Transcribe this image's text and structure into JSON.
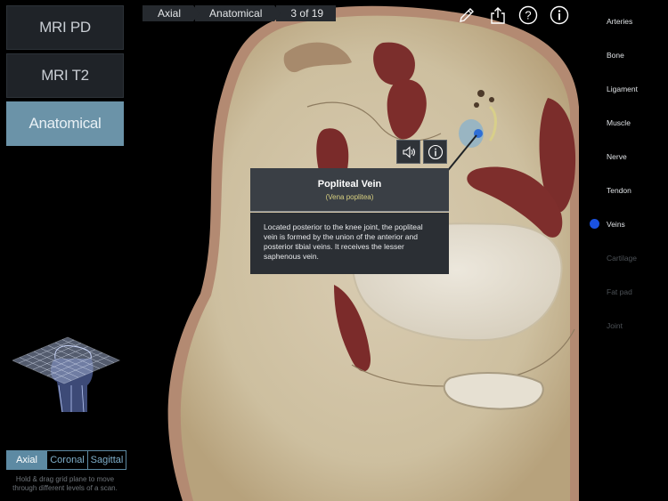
{
  "modes": [
    {
      "label": "MRI PD",
      "active": false
    },
    {
      "label": "MRI T2",
      "active": false
    },
    {
      "label": "Anatomical",
      "active": true
    }
  ],
  "breadcrumb": {
    "plane": "Axial",
    "mode": "Anatomical",
    "position": "3 of 19"
  },
  "toolbar": {
    "icons": [
      "pencil-icon",
      "share-icon",
      "help-icon",
      "info-icon"
    ]
  },
  "layers": [
    {
      "label": "Arteries",
      "enabled": true,
      "selected": false
    },
    {
      "label": "Bone",
      "enabled": true,
      "selected": false
    },
    {
      "label": "Ligament",
      "enabled": true,
      "selected": false
    },
    {
      "label": "Muscle",
      "enabled": true,
      "selected": false
    },
    {
      "label": "Nerve",
      "enabled": true,
      "selected": false
    },
    {
      "label": "Tendon",
      "enabled": true,
      "selected": false
    },
    {
      "label": "Veins",
      "enabled": true,
      "selected": true
    },
    {
      "label": "Cartilage",
      "enabled": false,
      "selected": false
    },
    {
      "label": "Fat pad",
      "enabled": false,
      "selected": false
    },
    {
      "label": "Joint",
      "enabled": false,
      "selected": false
    }
  ],
  "popup": {
    "title": "Popliteal Vein",
    "latin": "(Vena poplitea)",
    "description": "Located posterior to the knee joint, the popliteal vein is formed by the union of the anterior and posterior tibial veins. It receives the lesser saphenous vein.",
    "buttons": [
      "speaker-icon",
      "info-icon"
    ]
  },
  "planes": {
    "tabs": [
      {
        "label": "Axial",
        "active": true
      },
      {
        "label": "Coronal",
        "active": false
      },
      {
        "label": "Sagittal",
        "active": false
      }
    ],
    "hint": "Hold & drag grid plane to move through different levels of a scan."
  },
  "colors": {
    "accent": "#6b93a8",
    "selected_dot": "#1a52e0",
    "latin_text": "#d8d080"
  }
}
